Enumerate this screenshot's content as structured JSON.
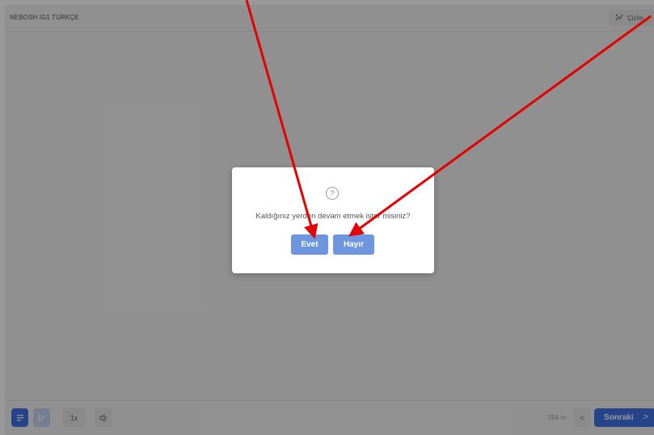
{
  "header": {
    "course_title": "NEBOSH IG1 TÜRKÇE",
    "draw_label": "Çizim",
    "draw_icon": "draw-icon"
  },
  "footer": {
    "list_icon": "list-icon",
    "play_icon": "play-icon",
    "speed_label": "1x",
    "volume_icon": "volume-icon",
    "duration": "254 m -",
    "prev_label": "<",
    "next_label": "Sonraki",
    "next_chevron": ">"
  },
  "dialog": {
    "icon": "?",
    "message": "Kaldığınız yerden devam etmek ister misiniz?",
    "yes_label": "Evet",
    "no_label": "Hayır"
  },
  "colors": {
    "accent": "#3f72e6",
    "dialog_button": "#6d95e0",
    "annotation_arrow": "#e60000"
  }
}
